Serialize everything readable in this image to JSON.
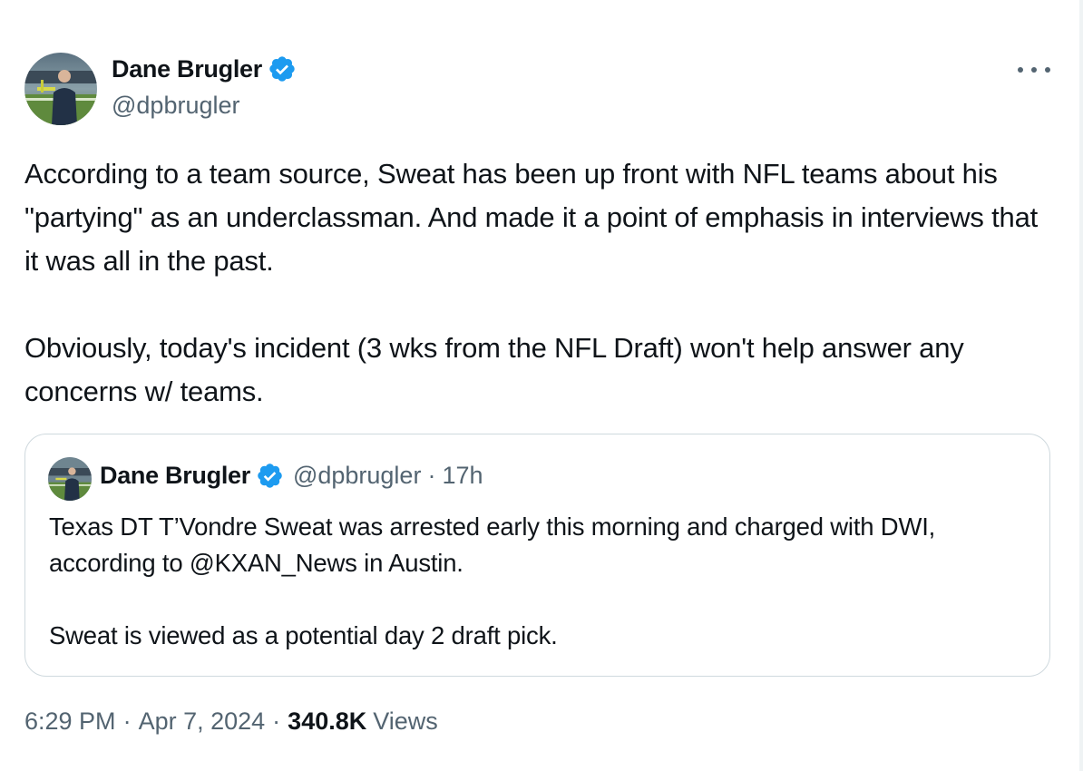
{
  "author": {
    "name": "Dane Brugler",
    "handle": "@dpbrugler",
    "verified": true
  },
  "more_icon": "more-horizontal-icon",
  "tweet_text": {
    "paragraph1": "According to a team source, Sweat has been up front with NFL teams about his \"partying\" as an underclassman. And made it a point of emphasis in interviews that it was all in the past.",
    "paragraph2": "Obviously, today's incident (3 wks from the NFL Draft) won't help answer any concerns w/ teams."
  },
  "quoted_tweet": {
    "name": "Dane Brugler",
    "handle": "@dpbrugler",
    "separator": "·",
    "time": "17h",
    "paragraph1": "Texas DT T’Vondre Sweat was arrested early this morning and charged with DWI, according to @KXAN_News in Austin.",
    "paragraph2": "Sweat is viewed as a potential day 2 draft pick."
  },
  "meta": {
    "time": "6:29 PM",
    "separator": "·",
    "date": "Apr 7, 2024",
    "views_count": "340.8K",
    "views_label": "Views"
  },
  "colors": {
    "text": "#0f1419",
    "secondary": "#536471",
    "verified_blue": "#1d9bf0",
    "border": "#cfd9de"
  }
}
